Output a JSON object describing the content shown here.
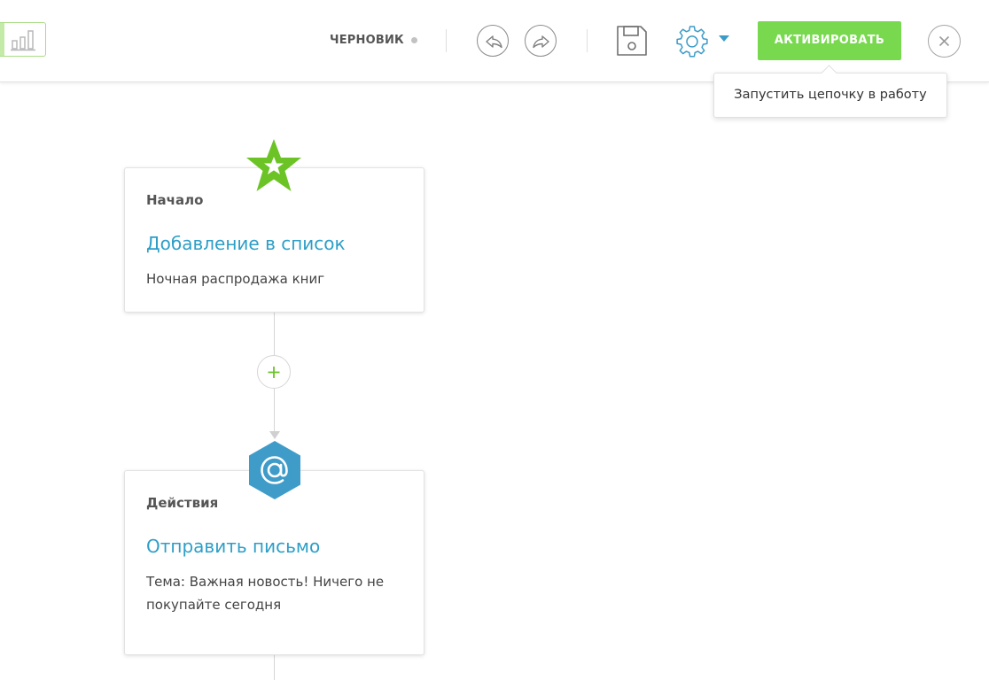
{
  "toolbar": {
    "status_label": "ЧЕРНОВИК",
    "activate_label": "АКТИВИРОВАТЬ",
    "tooltip_text": "Запустить цепочку в работу"
  },
  "flow": {
    "nodes": [
      {
        "category": "Начало",
        "title": "Добавление в список",
        "description": "Ночная распродажа книг",
        "badge_icon": "star-icon"
      },
      {
        "category": "Действия",
        "title": "Отправить письмо",
        "description": "Тема: Важная новость! Ничего не покупайте сегодня",
        "badge_icon": "email-icon"
      }
    ]
  },
  "icons": {
    "stats": "bar-chart-icon",
    "undo": "undo-icon",
    "redo": "redo-icon",
    "save": "save-icon",
    "settings": "gear-icon",
    "settings_menu": "caret-down-icon",
    "close": "close-icon",
    "add": "plus-icon"
  },
  "colors": {
    "accent_green": "#78d94f",
    "link_blue": "#2d9ec7",
    "start_badge": "#6cc326",
    "action_badge": "#3f9cc9"
  }
}
